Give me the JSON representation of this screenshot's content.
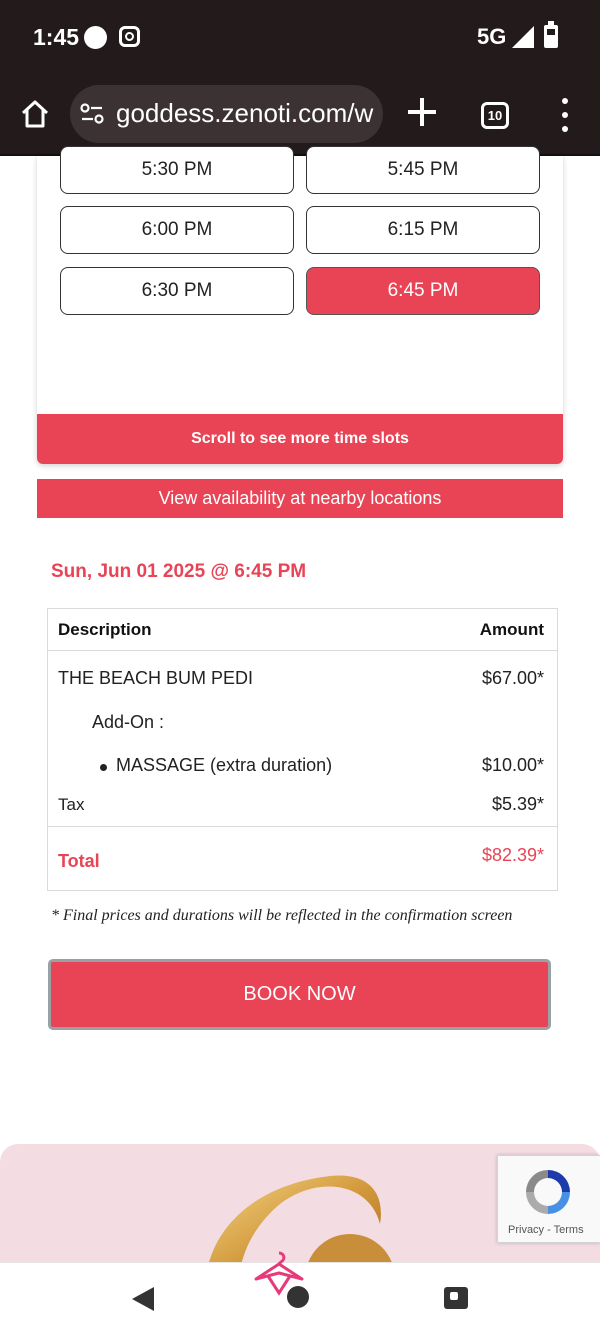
{
  "status_bar": {
    "time": "1:45",
    "network": "5G"
  },
  "browser": {
    "url": "goddess.zenoti.com/w",
    "tab_count": "10"
  },
  "time_slots": [
    {
      "label": "5:30 PM",
      "selected": false
    },
    {
      "label": "5:45 PM",
      "selected": false
    },
    {
      "label": "6:00 PM",
      "selected": false
    },
    {
      "label": "6:15 PM",
      "selected": false
    },
    {
      "label": "6:30 PM",
      "selected": false
    },
    {
      "label": "6:45 PM",
      "selected": true
    }
  ],
  "scroll_hint": "Scroll to see more time slots",
  "nearby_button": "View availability at nearby locations",
  "appointment": {
    "datetime": "Sun, Jun 01 2025 @ 6:45 PM"
  },
  "summary": {
    "headers": {
      "description": "Description",
      "amount": "Amount"
    },
    "service": {
      "name": "THE BEACH BUM PEDI",
      "amount": "$67.00*"
    },
    "addon_label": "Add-On :",
    "addon": {
      "name": "MASSAGE (extra duration)",
      "amount": "$10.00*"
    },
    "tax": {
      "label": "Tax",
      "amount": "$5.39*"
    },
    "total": {
      "label": "Total",
      "amount": "$82.39*"
    }
  },
  "disclaimer": "* Final prices and durations will be reflected in the confirmation screen",
  "book_button": "BOOK NOW",
  "recaptcha": {
    "privacy": "Privacy",
    "separator": " - ",
    "terms": "Terms"
  },
  "colors": {
    "accent": "#e84455",
    "chrome": "#231a1b",
    "footer_bg": "#f3dde3"
  },
  "icons": [
    "home-icon",
    "site-settings-icon",
    "new-tab-icon",
    "tab-switcher-icon",
    "overflow-menu-icon",
    "back-icon",
    "home-nav-icon",
    "recents-icon"
  ]
}
